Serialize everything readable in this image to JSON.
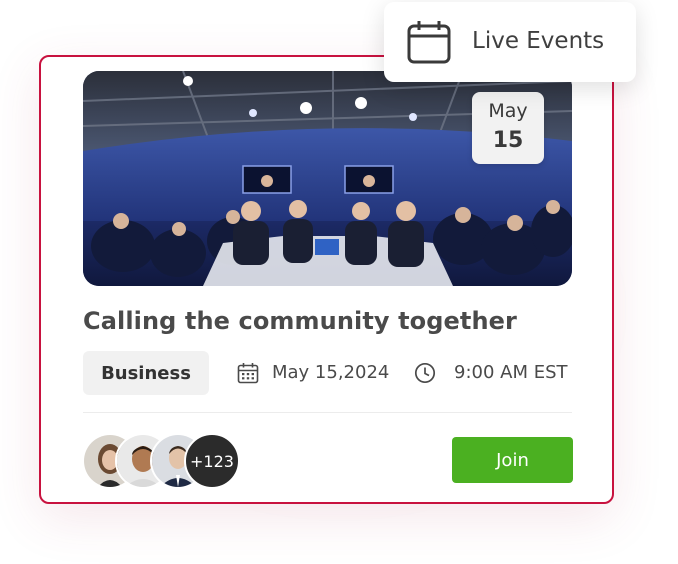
{
  "badge": {
    "label": "Live Events",
    "icon": "calendar-icon"
  },
  "event": {
    "date_badge": {
      "month": "May",
      "day": "15"
    },
    "title": "Calling the community together",
    "category": "Business",
    "date": "May 15,2024",
    "time": "9:00 AM EST",
    "attendees_more": "+123",
    "join_label": "Join"
  },
  "colors": {
    "card_border": "#c8123f",
    "join_button": "#4bb021",
    "tag_background": "#f1f1f1"
  }
}
